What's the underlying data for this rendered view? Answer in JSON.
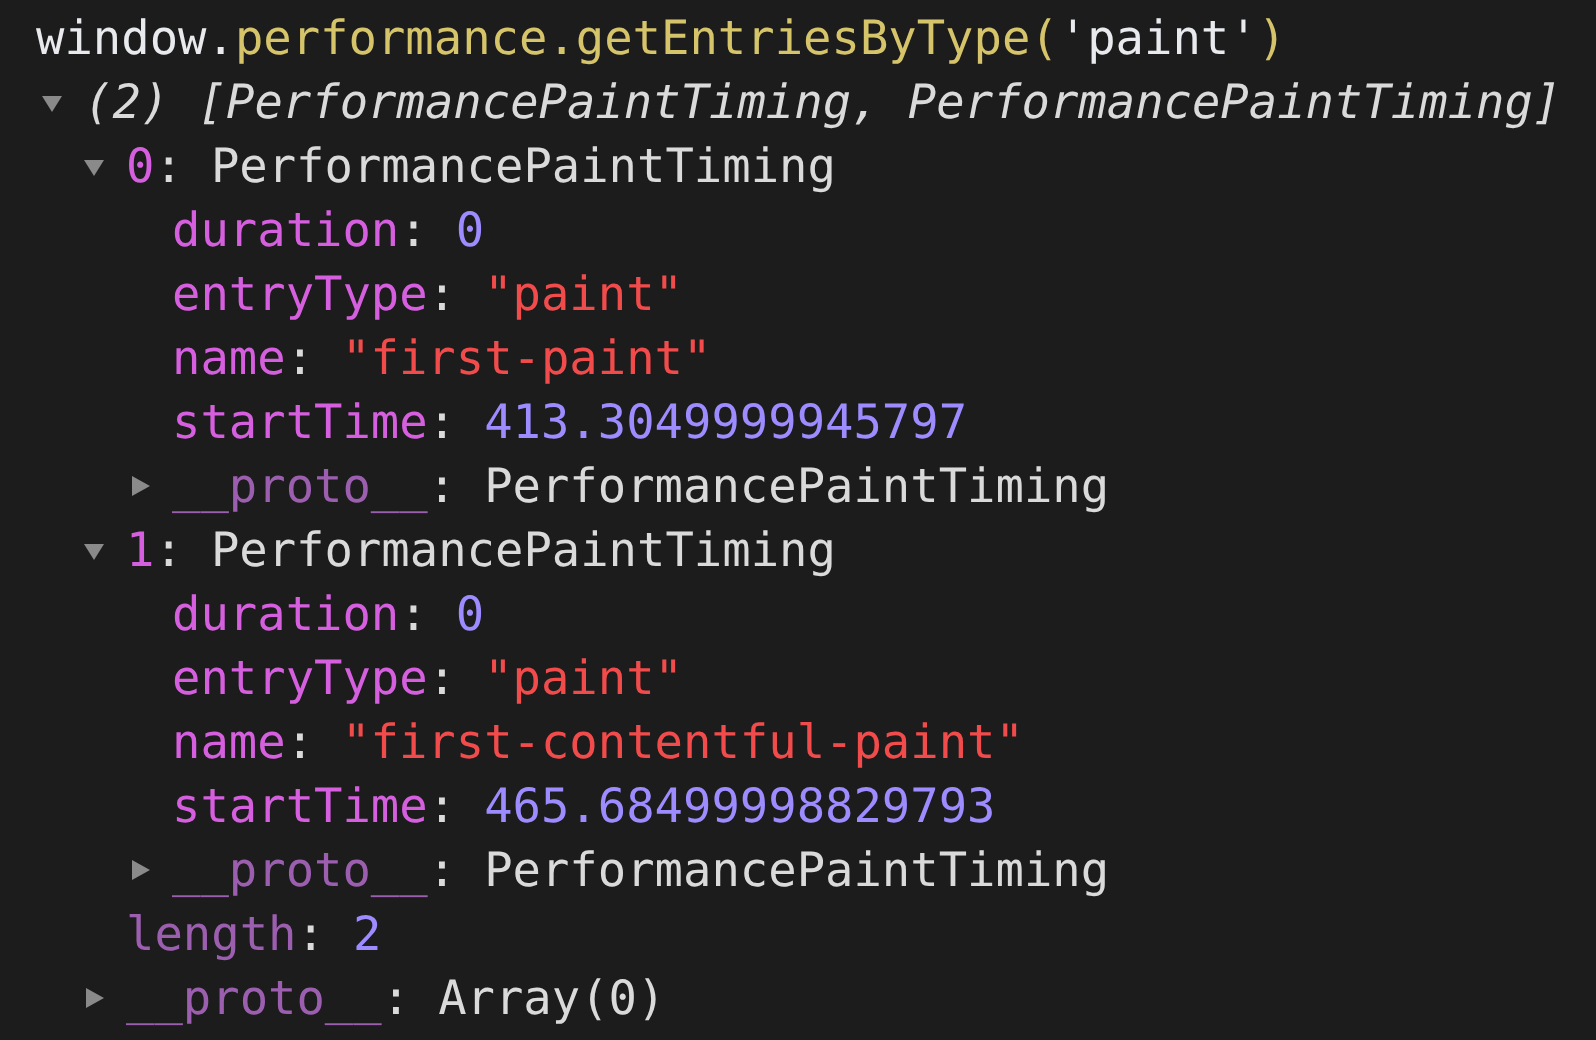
{
  "command": [
    {
      "kind": "plain",
      "text": "window."
    },
    {
      "kind": "member",
      "text": "performance.getEntriesByType("
    },
    {
      "kind": "string",
      "text": "'paint'"
    },
    {
      "kind": "member",
      "text": ")"
    }
  ],
  "result": {
    "summary": "(2) [PerformancePaintTiming, PerformancePaintTiming]",
    "expanded": true,
    "children": [
      {
        "kind": "entry",
        "key": "0",
        "separator": ":",
        "value": "PerformancePaintTiming",
        "expanded": true,
        "children": [
          {
            "kind": "number",
            "key": "duration",
            "separator": ":",
            "value": "0"
          },
          {
            "kind": "string",
            "key": "entryType",
            "separator": ":",
            "value": "\"paint\""
          },
          {
            "kind": "string",
            "key": "name",
            "separator": ":",
            "value": "\"first-paint\""
          },
          {
            "kind": "number",
            "key": "startTime",
            "separator": ":",
            "value": "413.3049999945797"
          },
          {
            "kind": "proto",
            "key": "__proto__",
            "separator": ":",
            "value": "PerformancePaintTiming",
            "expanded": false
          }
        ]
      },
      {
        "kind": "entry",
        "key": "1",
        "separator": ":",
        "value": "PerformancePaintTiming",
        "expanded": true,
        "children": [
          {
            "kind": "number",
            "key": "duration",
            "separator": ":",
            "value": "0"
          },
          {
            "kind": "string",
            "key": "entryType",
            "separator": ":",
            "value": "\"paint\""
          },
          {
            "kind": "string",
            "key": "name",
            "separator": ":",
            "value": "\"first-contentful-paint\""
          },
          {
            "kind": "number",
            "key": "startTime",
            "separator": ":",
            "value": "465.68499998829793"
          },
          {
            "kind": "proto",
            "key": "__proto__",
            "separator": ":",
            "value": "PerformancePaintTiming",
            "expanded": false
          }
        ]
      },
      {
        "kind": "count",
        "key": "length",
        "separator": ":",
        "value": "2"
      },
      {
        "kind": "proto",
        "key": "__proto__",
        "separator": ":",
        "value": "Array(0)",
        "expanded": false
      }
    ]
  }
}
